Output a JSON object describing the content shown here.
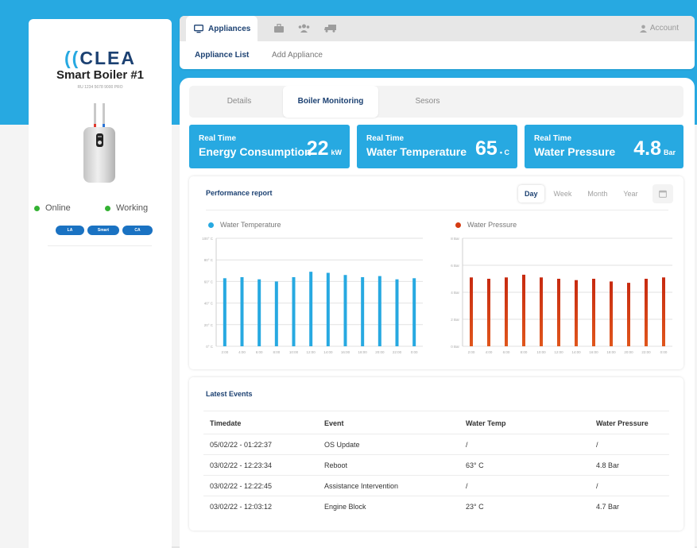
{
  "brand": {
    "logo_paren": "((",
    "logo_text": "CLEA"
  },
  "device": {
    "name": "Smart Boiler #1",
    "serial": "RU 1234 5678 9000 PRO",
    "statuses": [
      {
        "label": "Online"
      },
      {
        "label": "Working"
      }
    ],
    "tags": [
      "LA",
      "Smart",
      "CA"
    ]
  },
  "nav": {
    "active_tab": "Appliances",
    "icons": [
      "briefcase-icon",
      "users-icon",
      "truck-icon"
    ],
    "account": "Account",
    "subtabs": [
      "Appliance List",
      "Add Appliance"
    ]
  },
  "sections": [
    "Details",
    "Boiler Monitoring",
    "Sesors"
  ],
  "kpis": [
    {
      "line1": "Real Time",
      "line2": "Energy Consumption",
      "value": "22",
      "unit": "kW"
    },
    {
      "line1": "Real Time",
      "line2": "Water Temperature",
      "value": "65",
      "unit": "• C"
    },
    {
      "line1": "Real Time",
      "line2": "Water Pressure",
      "value": "4.8",
      "unit": "Bar"
    }
  ],
  "performance": {
    "title": "Performance report",
    "periods": [
      "Day",
      "Week",
      "Month",
      "Year"
    ],
    "active_period": "Day"
  },
  "colors": {
    "accent": "#27a9e1",
    "navy": "#1c4172",
    "online": "#34b233",
    "pressure": "#d43b12",
    "tag": "#1a72c2"
  },
  "chart_data": [
    {
      "type": "bar",
      "series_name": "Water Temperature",
      "categories": [
        "2:00",
        "4:00",
        "6:00",
        "8:00",
        "10:00",
        "12:00",
        "14:00",
        "16:00",
        "18:00",
        "20:00",
        "22:00",
        "0:00"
      ],
      "values": [
        63,
        64,
        62,
        60,
        64,
        69,
        68,
        66,
        64,
        65,
        62,
        63
      ],
      "yticks": [
        "0° C",
        "20° C",
        "40° C",
        "60° C",
        "80° C",
        "100° C"
      ],
      "ylim": [
        0,
        100
      ],
      "color": "#27a9e1",
      "grid": true
    },
    {
      "type": "bar",
      "series_name": "Water Pressure",
      "categories": [
        "2:00",
        "4:00",
        "6:00",
        "8:00",
        "10:00",
        "12:00",
        "14:00",
        "16:00",
        "18:00",
        "20:00",
        "22:00",
        "0:00"
      ],
      "values": [
        5.1,
        5.0,
        5.1,
        5.3,
        5.1,
        5.0,
        4.9,
        5.0,
        4.8,
        4.7,
        5.0,
        5.1
      ],
      "yticks": [
        "0 Bar",
        "2 Bar",
        "4 Bar",
        "6 Bar",
        "8 Bar"
      ],
      "ylim": [
        0,
        8
      ],
      "color": "#d43b12",
      "grid": true
    }
  ],
  "events": {
    "title": "Latest Events",
    "columns": [
      "Timedate",
      "Event",
      "Water Temp",
      "Water Pressure"
    ],
    "rows": [
      [
        "05/02/22 - 01:22:37",
        "OS Update",
        "/",
        "/"
      ],
      [
        "03/02/22 - 12:23:34",
        "Reboot",
        "63° C",
        "4.8 Bar"
      ],
      [
        "03/02/22 - 12:22:45",
        "Assistance Intervention",
        "/",
        "/"
      ],
      [
        "03/02/22 - 12:03:12",
        "Engine Block",
        "23° C",
        "4.7 Bar"
      ]
    ]
  }
}
